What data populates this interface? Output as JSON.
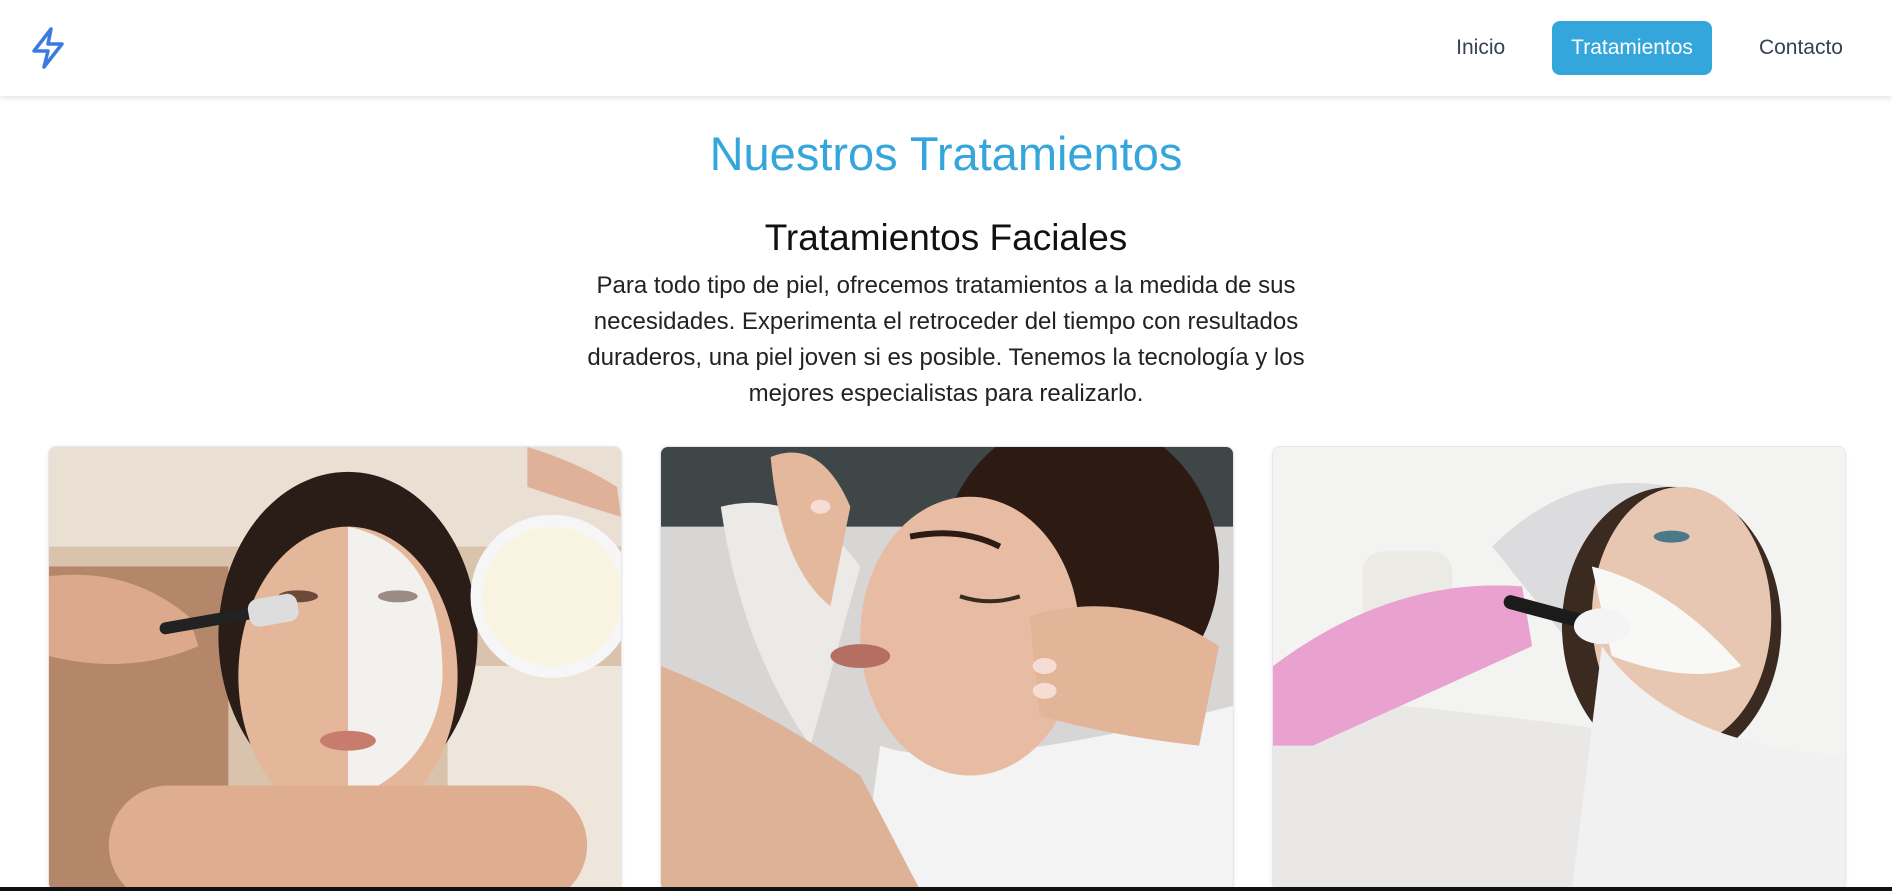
{
  "nav": {
    "logo_icon": "lightning-bolt-icon",
    "links": [
      {
        "label": "Inicio",
        "active": false
      },
      {
        "label": "Tratamientos",
        "active": true
      },
      {
        "label": "Contacto",
        "active": false
      }
    ]
  },
  "main": {
    "title": "Nuestros Tratamientos",
    "section": {
      "title": "Tratamientos Faciales",
      "description": "Para todo tipo de piel, ofrecemos tratamientos a la medida de sus necesidades. Experimenta el retroceder del tiempo con resultados duraderos, una piel joven si es posible. Tenemos la tecnología y los mejores especialistas para realizarlo."
    },
    "cards": [
      {
        "image": "woman-facial-mask-brush-photo"
      },
      {
        "image": "woman-facial-massage-photo"
      },
      {
        "image": "woman-facial-peel-brush-photo"
      }
    ]
  },
  "colors": {
    "accent": "#34a6dc",
    "logo": "#3b7be0",
    "text": "#111111",
    "nav_text": "#374151"
  }
}
